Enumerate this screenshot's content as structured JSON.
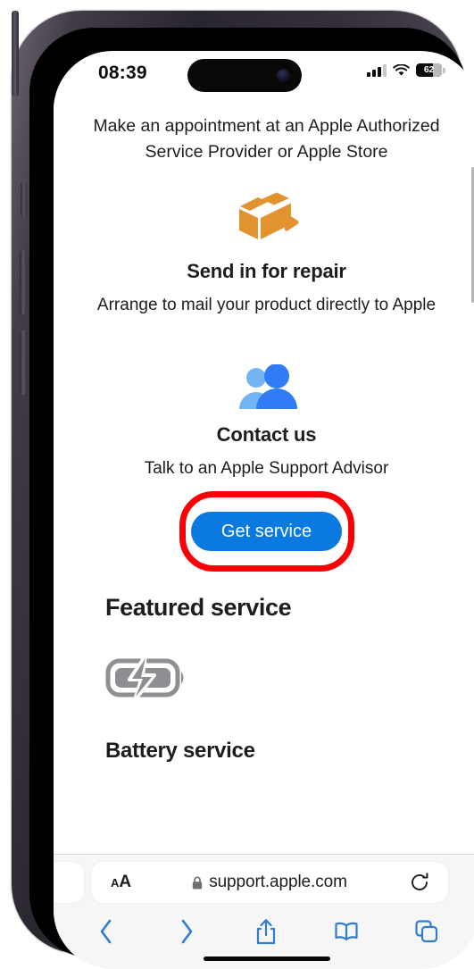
{
  "status_bar": {
    "time": "08:39",
    "battery_percent": "62",
    "signal_icon": "cellular-signal-icon",
    "wifi_icon": "wifi-icon"
  },
  "page": {
    "intro_text": "Make an appointment at an Apple Authorized Service Provider or Apple Store",
    "options": [
      {
        "icon": "shipping-box-arrow-icon",
        "icon_color": "#e2932f",
        "title": "Send in for repair",
        "subtitle": "Arrange to mail your product directly to Apple"
      },
      {
        "icon": "two-people-icon",
        "icon_color": "#2f7cf6",
        "title": "Contact us",
        "subtitle": "Talk to an Apple Support Advisor"
      }
    ],
    "cta_label": "Get service",
    "cta_color": "#0b7ae0",
    "highlight_color": "#fb0007",
    "featured_heading": "Featured service",
    "featured_item": {
      "icon": "battery-charging-icon",
      "icon_color": "#8e8e93",
      "title": "Battery service"
    }
  },
  "browser": {
    "text_size_small": "A",
    "text_size_large": "A",
    "lock_icon": "lock-icon",
    "url": "support.apple.com",
    "reload_icon": "reload-icon",
    "toolbar": [
      {
        "name": "back-button",
        "icon": "chevron-left-icon"
      },
      {
        "name": "forward-button",
        "icon": "chevron-right-icon"
      },
      {
        "name": "share-button",
        "icon": "share-icon"
      },
      {
        "name": "bookmarks-button",
        "icon": "book-icon"
      },
      {
        "name": "tabs-button",
        "icon": "tabs-icon"
      }
    ],
    "accent_color": "#2f7cd0"
  }
}
